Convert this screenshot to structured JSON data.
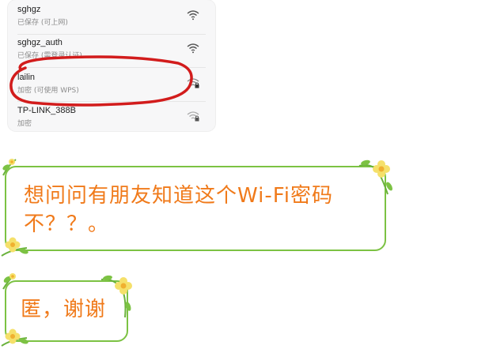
{
  "wifi_list": [
    {
      "name": "sghgz",
      "status": "已保存 (可上网)",
      "locked": false
    },
    {
      "name": "sghgz_auth",
      "status": "已保存 (需登录认证)",
      "locked": false
    },
    {
      "name": "lailin",
      "status": "加密 (可使用 WPS)",
      "locked": true
    },
    {
      "name": "TP-LINK_388B",
      "status": "加密",
      "locked": true
    }
  ],
  "annotation": {
    "color": "#d21c1c"
  },
  "messages": [
    {
      "line1": "想问问有朋友知道这个Wi-Fi密码",
      "line2": "不？？。"
    },
    {
      "line1": "匿，谢谢"
    }
  ],
  "colors": {
    "bubble_border": "#7cc243",
    "text": "#f07a1a",
    "flower": "#f5e06a"
  }
}
